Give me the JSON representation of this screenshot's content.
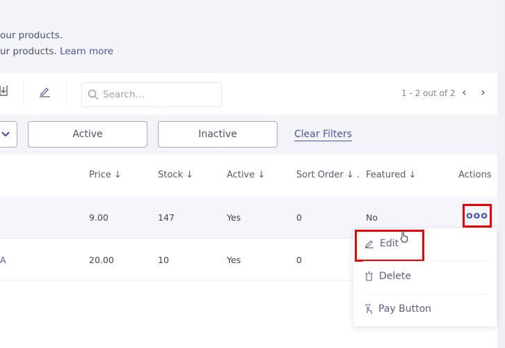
{
  "intro": {
    "line1": "our products.",
    "line2": "ur products.",
    "learn_more": "Learn more"
  },
  "toolbar": {
    "search_placeholder": "Search...",
    "pagination": "1 - 2 out of 2",
    "prev": "‹",
    "next": "›"
  },
  "filters": {
    "active": "Active",
    "inactive": "Inactive",
    "clear": "Clear Filters"
  },
  "table": {
    "headers": [
      "Price ↓",
      "Stock ↓",
      "Active ↓",
      "Sort Order ↓ .",
      "Featured ↓",
      "Actions"
    ],
    "rows": [
      {
        "name": "",
        "price": "9.00",
        "stock": "147",
        "active": "Yes",
        "sort": "0",
        "featured": "No"
      },
      {
        "name": "A",
        "price": "20.00",
        "stock": "10",
        "active": "Yes",
        "sort": "0",
        "featured": ""
      }
    ]
  },
  "actions_menu": {
    "trigger": "ooo",
    "items": [
      "Edit",
      "Delete",
      "Pay Button"
    ]
  },
  "colors": {
    "accent": "#4a55a2",
    "highlight": "#ee0000"
  }
}
